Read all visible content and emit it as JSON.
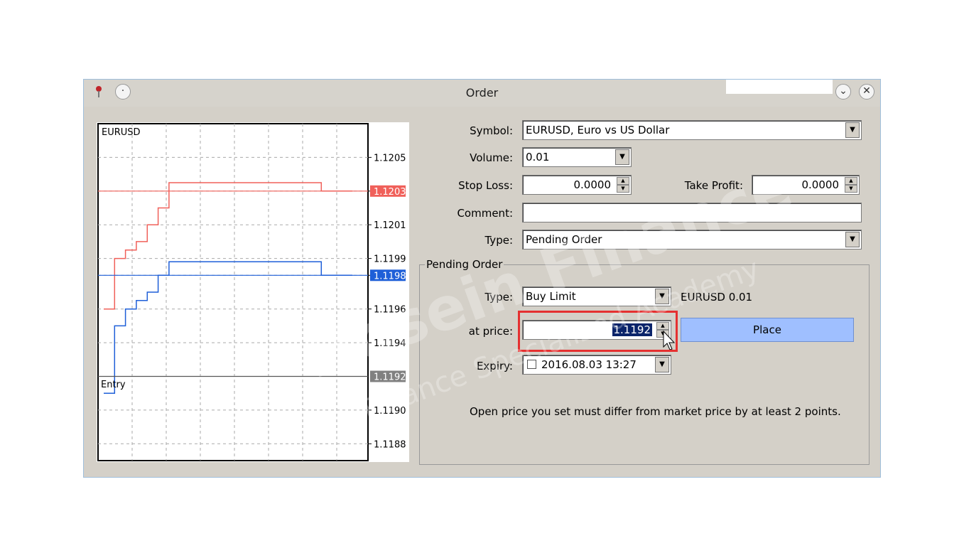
{
  "window": {
    "title": "Order",
    "minimize_glyph": "⌄",
    "close_glyph": "✕",
    "left_icon_glyph": "·"
  },
  "chart": {
    "symbol": "EURUSD",
    "entry_label": "Entry",
    "y_ticks": [
      "1.1205",
      "1.1203",
      "1.1201",
      "1.1199",
      "1.1198",
      "1.1196",
      "1.1194",
      "1.1190",
      "1.1188"
    ],
    "ask_tag": "1.1203",
    "bid_tag": "1.1198",
    "entry_tag": "1.1192",
    "colors": {
      "ask": "#f0605a",
      "bid": "#1e5fd8",
      "entry": "#808080"
    }
  },
  "chart_data": {
    "type": "line",
    "ylim": [
      1.1187,
      1.1207
    ],
    "series": [
      {
        "values": [
          1.1196,
          1.1199,
          1.11995,
          1.12,
          1.1201,
          1.1202,
          1.12035,
          1.1203,
          1.1203
        ]
      },
      {
        "values": [
          1.1191,
          1.1195,
          1.1196,
          1.11965,
          1.1197,
          1.1198,
          1.11988,
          1.1198,
          1.1198
        ]
      }
    ],
    "hlines": [
      {
        "y": 1.1203
      },
      {
        "y": 1.1198
      },
      {
        "label": "Entry",
        "y": 1.1192
      }
    ]
  },
  "form": {
    "symbol_label": "Symbol:",
    "symbol_value": "EURUSD, Euro vs US Dollar",
    "volume_label": "Volume:",
    "volume_value": "0.01",
    "stoploss_label": "Stop Loss:",
    "stoploss_value": "0.0000",
    "takeprofit_label": "Take Profit:",
    "takeprofit_value": "0.0000",
    "comment_label": "Comment:",
    "comment_value": "",
    "type_label": "Type:",
    "type_value": "Pending Order"
  },
  "pending": {
    "group_title": "Pending Order",
    "type_label": "Type:",
    "type_value": "Buy Limit",
    "type_info": "EURUSD 0.01",
    "price_label": "at price:",
    "price_value": "1.1192",
    "place_label": "Place",
    "expiry_label": "Expiry:",
    "expiry_value": "2016.08.03 13:27",
    "expiry_checked": false,
    "hint": "Open price you set must differ from market price by at least 2 points."
  },
  "watermark": {
    "line1": "Hosein Finance",
    "line2": "Finance Specialized Academy"
  }
}
